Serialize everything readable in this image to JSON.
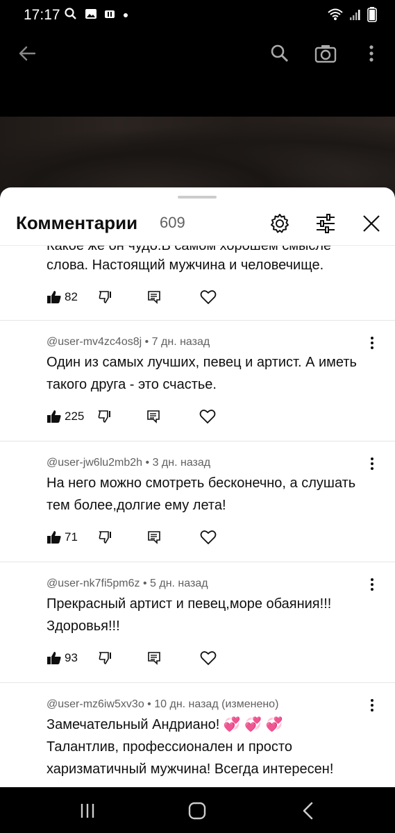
{
  "status": {
    "time": "17:17",
    "battery": "battery-icon"
  },
  "sheet": {
    "title": "Комментарии",
    "count": "609"
  },
  "comments": [
    {
      "author": "",
      "age": "",
      "text_partial_top": "Какое же он чудо.В самом хорошем смысле",
      "text": "слова. Настоящий мужчина и человечище.",
      "likes": "82"
    },
    {
      "author": "@user-mv4zc4os8j",
      "age": "7 дн. назад",
      "text": "Один из самых лучших, певец и артист. А иметь такого друга - это счастье.",
      "likes": "225"
    },
    {
      "author": "@user-jw6lu2mb2h",
      "age": "3 дн. назад",
      "text": "На него можно смотреть бесконечно, а слушать тем более,долгие ему лета!",
      "likes": "71"
    },
    {
      "author": "@user-nk7fi5pm6z",
      "age": "5 дн. назад",
      "text": "Прекрасный артист и певец,море обаяния!!! Здоровья!!!",
      "likes": "93"
    },
    {
      "author": "@user-mz6iw5xv3o",
      "age": "10 дн. назад (изменено)",
      "text_line1": "Замечательный Андриано!",
      "text_line2": "Талантлив, профессионален и просто харизматичный мужчина! Всегда интересен!",
      "emoji": "💞 💞 💞",
      "likes": ""
    }
  ],
  "separator": " • "
}
